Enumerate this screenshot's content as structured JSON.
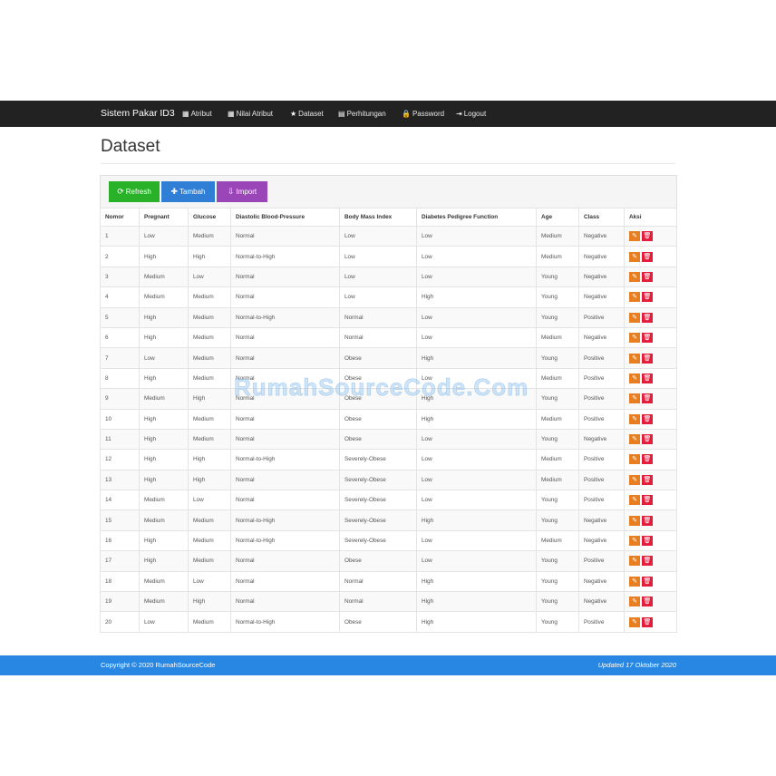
{
  "navbar": {
    "brand": "Sistem Pakar ID3",
    "items": [
      {
        "icon": "grid-icon",
        "glyph": "▦",
        "label": "Atribut"
      },
      {
        "icon": "list-grid-icon",
        "glyph": "▦",
        "label": "Nilai Atribut"
      },
      {
        "icon": "star-icon",
        "glyph": "★",
        "label": "Dataset"
      },
      {
        "icon": "calendar-icon",
        "glyph": "▤",
        "label": "Perhitungan"
      },
      {
        "icon": "lock-icon",
        "glyph": "🔒",
        "label": "Password"
      },
      {
        "icon": "logout-icon",
        "glyph": "⇥",
        "label": "Logout"
      }
    ]
  },
  "page": {
    "title": "Dataset"
  },
  "toolbar": {
    "refresh_label": "Refresh",
    "tambah_label": "Tambah",
    "import_label": "Import"
  },
  "table": {
    "headers": [
      "Nomor",
      "Pregnant",
      "Glucose",
      "Diastolic Blood-Pressure",
      "Body Mass Index",
      "Diabetes Pedigree Function",
      "Age",
      "Class",
      "Aksi"
    ],
    "rows": [
      [
        "1",
        "Low",
        "Medium",
        "Normal",
        "Low",
        "Low",
        "Medium",
        "Negative"
      ],
      [
        "2",
        "High",
        "High",
        "Normal-to-High",
        "Low",
        "Low",
        "Medium",
        "Negative"
      ],
      [
        "3",
        "Medium",
        "Low",
        "Normal",
        "Low",
        "Low",
        "Young",
        "Negative"
      ],
      [
        "4",
        "Medium",
        "Medium",
        "Normal",
        "Low",
        "High",
        "Young",
        "Negative"
      ],
      [
        "5",
        "High",
        "Medium",
        "Normal-to-High",
        "Normal",
        "Low",
        "Young",
        "Positive"
      ],
      [
        "6",
        "High",
        "Medium",
        "Normal",
        "Normal",
        "Low",
        "Medium",
        "Negative"
      ],
      [
        "7",
        "Low",
        "Medium",
        "Normal",
        "Obese",
        "High",
        "Young",
        "Positive"
      ],
      [
        "8",
        "High",
        "Medium",
        "Normal",
        "Obese",
        "Low",
        "Medium",
        "Positive"
      ],
      [
        "9",
        "Medium",
        "High",
        "Normal",
        "Obese",
        "High",
        "Young",
        "Positive"
      ],
      [
        "10",
        "High",
        "Medium",
        "Normal",
        "Obese",
        "High",
        "Medium",
        "Positive"
      ],
      [
        "11",
        "High",
        "Medium",
        "Normal",
        "Obese",
        "Low",
        "Young",
        "Negative"
      ],
      [
        "12",
        "High",
        "High",
        "Normal-to-High",
        "Severely-Obese",
        "Low",
        "Medium",
        "Positive"
      ],
      [
        "13",
        "High",
        "High",
        "Normal",
        "Severely-Obese",
        "Low",
        "Medium",
        "Positive"
      ],
      [
        "14",
        "Medium",
        "Low",
        "Normal",
        "Severely-Obese",
        "Low",
        "Young",
        "Positive"
      ],
      [
        "15",
        "Medium",
        "Medium",
        "Normal-to-High",
        "Severely-Obese",
        "High",
        "Young",
        "Negative"
      ],
      [
        "16",
        "High",
        "Medium",
        "Normal-to-High",
        "Severely-Obese",
        "Low",
        "Medium",
        "Negative"
      ],
      [
        "17",
        "High",
        "Medium",
        "Normal",
        "Obese",
        "Low",
        "Young",
        "Positive"
      ],
      [
        "18",
        "Medium",
        "Low",
        "Normal",
        "Normal",
        "High",
        "Young",
        "Negative"
      ],
      [
        "19",
        "Medium",
        "High",
        "Normal",
        "Normal",
        "High",
        "Young",
        "Negative"
      ],
      [
        "20",
        "Low",
        "Medium",
        "Normal-to-High",
        "Obese",
        "High",
        "Young",
        "Positive"
      ]
    ]
  },
  "watermark": "RumahSourceCode.Com",
  "footer": {
    "copyright": "Copyright © 2020 RumahSourceCode",
    "updated": "Updated 17 Oktober 2020"
  },
  "colors": {
    "navbar": "#222222",
    "refresh": "#2ab12a",
    "tambah": "#2f7fd6",
    "import": "#9a45b8",
    "edit": "#e87e22",
    "delete": "#e21e3c",
    "footer": "#2887e3"
  }
}
